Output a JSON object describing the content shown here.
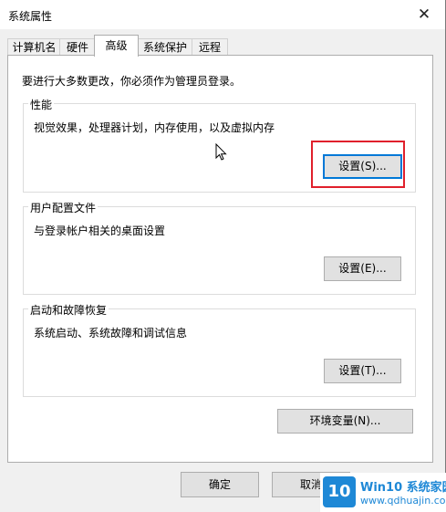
{
  "window": {
    "title": "系统属性"
  },
  "tabs": [
    {
      "label": "计算机名"
    },
    {
      "label": "硬件"
    },
    {
      "label": "高级"
    },
    {
      "label": "系统保护"
    },
    {
      "label": "远程"
    }
  ],
  "admin_note": "要进行大多数更改，你必须作为管理员登录。",
  "performance": {
    "title": "性能",
    "description": "视觉效果，处理器计划，内存使用，以及虚拟内存",
    "button": "设置(S)..."
  },
  "user_profiles": {
    "title": "用户配置文件",
    "description": "与登录帐户相关的桌面设置",
    "button": "设置(E)..."
  },
  "startup_recovery": {
    "title": "启动和故障恢复",
    "description": "系统启动、系统故障和调试信息",
    "button": "设置(T)..."
  },
  "env_button": "环境变量(N)...",
  "footer": {
    "ok": "确定",
    "cancel": "取消"
  },
  "watermark": {
    "logo": "10",
    "line1": "Win10 系统家园",
    "line2": "www.qdhuajin.com"
  },
  "icons": {
    "close": "close-icon",
    "cursor": "mouse-cursor-icon"
  },
  "colors": {
    "highlight": "#e0202c",
    "focus": "#0078d7",
    "watermark": "#1e88d6"
  }
}
